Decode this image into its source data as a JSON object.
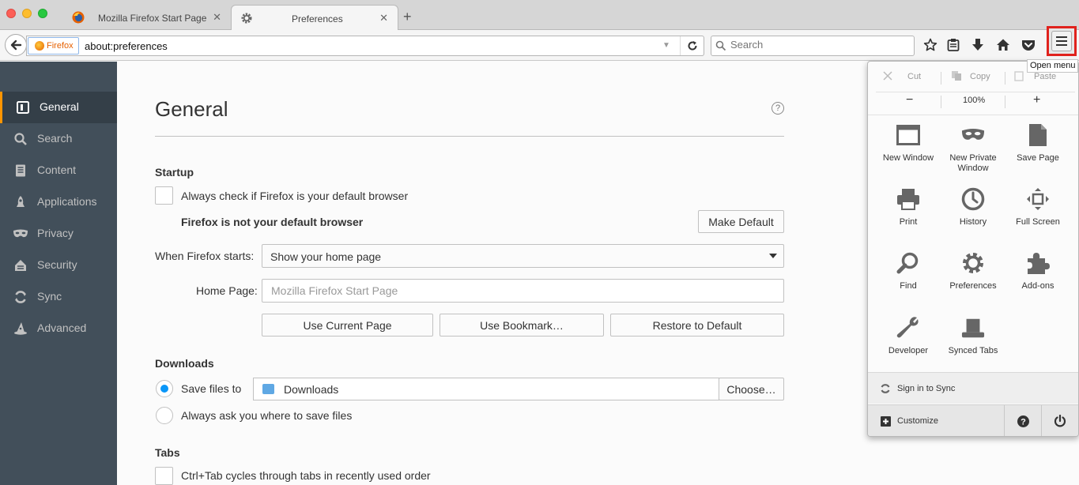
{
  "tabs": [
    {
      "title": "Mozilla Firefox Start Page"
    },
    {
      "title": "Preferences"
    }
  ],
  "navbar": {
    "identity_label": "Firefox",
    "url": "about:preferences",
    "search_placeholder": "Search",
    "menu_tooltip": "Open menu"
  },
  "sidebar": {
    "items": [
      {
        "label": "General"
      },
      {
        "label": "Search"
      },
      {
        "label": "Content"
      },
      {
        "label": "Applications"
      },
      {
        "label": "Privacy"
      },
      {
        "label": "Security"
      },
      {
        "label": "Sync"
      },
      {
        "label": "Advanced"
      }
    ]
  },
  "main": {
    "title": "General",
    "help": "?",
    "startup": {
      "heading": "Startup",
      "default_check_label": "Always check if Firefox is your default browser",
      "not_default_text": "Firefox is not your default browser",
      "make_default": "Make Default",
      "when_starts_label": "When Firefox starts:",
      "when_starts_value": "Show your home page",
      "home_page_label": "Home Page:",
      "home_page_placeholder": "Mozilla Firefox Start Page",
      "use_current": "Use Current Page",
      "use_bookmark": "Use Bookmark…",
      "restore_default": "Restore to Default"
    },
    "downloads": {
      "heading": "Downloads",
      "save_files_label": "Save files to",
      "folder": "Downloads",
      "choose": "Choose…",
      "always_ask_label": "Always ask you where to save files"
    },
    "tabs_section": {
      "heading": "Tabs",
      "ctrl_tab_label": "Ctrl+Tab cycles through tabs in recently used order"
    }
  },
  "panel": {
    "cut": "Cut",
    "copy": "Copy",
    "paste": "Paste",
    "zoom_out": "−",
    "zoom_level": "100%",
    "zoom_in": "+",
    "items": [
      {
        "label": "New Window",
        "icon": "new-window-icon"
      },
      {
        "label": "New Private Window",
        "icon": "private-mask-icon"
      },
      {
        "label": "Save Page",
        "icon": "save-page-icon"
      },
      {
        "label": "Print",
        "icon": "printer-icon"
      },
      {
        "label": "History",
        "icon": "clock-icon"
      },
      {
        "label": "Full Screen",
        "icon": "fullscreen-icon"
      },
      {
        "label": "Find",
        "icon": "magnifier-icon"
      },
      {
        "label": "Preferences",
        "icon": "gear-icon"
      },
      {
        "label": "Add-ons",
        "icon": "puzzle-icon"
      },
      {
        "label": "Developer",
        "icon": "wrench-icon"
      },
      {
        "label": "Synced Tabs",
        "icon": "synced-tabs-icon"
      }
    ],
    "sign_in": "Sign in to Sync",
    "customize": "Customize"
  },
  "colors": {
    "sidebar_bg": "#424f5a",
    "sidebar_selected": "#343f48",
    "accent_orange": "#ff9500",
    "radio_blue": "#0996f8",
    "highlight_red": "#e0221d"
  }
}
